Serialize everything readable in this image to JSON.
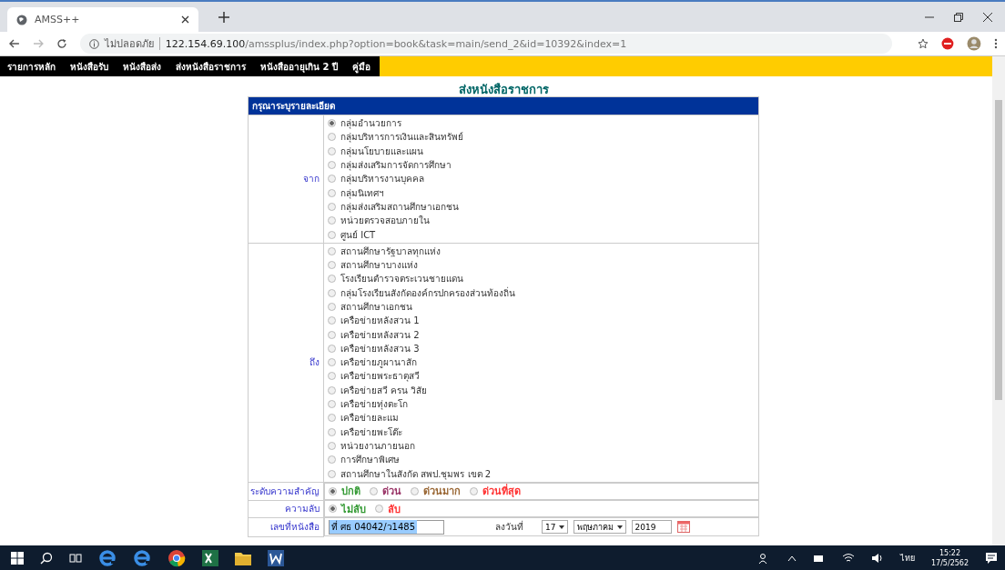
{
  "browser": {
    "tab_title": "AMSS++",
    "security": "ไม่ปลอดภัย",
    "url_host": "122.154.69.100",
    "url_path": "/amssplus/index.php?option=book&task=main/send_2&id=10392&index=1"
  },
  "nav": [
    "รายการหลัก",
    "หนังสือรับ",
    "หนังสือส่ง",
    "ส่งหนังสือราชการ",
    "หนังสืออายุเกิน 2 ปี",
    "คู่มือ"
  ],
  "page_title": "ส่งหนังสือราชการ",
  "form_header": "กรุณาระบุรายละเอียด",
  "from": {
    "label": "จาก",
    "options": [
      {
        "label": "กลุ่มอำนวยการ",
        "selected": true
      },
      {
        "label": "กลุ่มบริหารการเงินและสินทรัพย์",
        "selected": false
      },
      {
        "label": "กลุ่มนโยบายและแผน",
        "selected": false
      },
      {
        "label": "กลุ่มส่งเสริมการจัดการศึกษา",
        "selected": false
      },
      {
        "label": "กลุ่มบริหารงานบุคคล",
        "selected": false
      },
      {
        "label": "กลุ่มนิเทศฯ",
        "selected": false
      },
      {
        "label": "กลุ่มส่งเสริมสถานศึกษาเอกชน",
        "selected": false
      },
      {
        "label": "หน่วยตรวจสอบภายใน",
        "selected": false
      },
      {
        "label": "ศูนย์ ICT",
        "selected": false
      }
    ]
  },
  "to": {
    "label": "ถึง",
    "options": [
      {
        "label": "สถานศึกษารัฐบาลทุกแห่ง",
        "selected": false
      },
      {
        "label": "สถานศึกษาบางแห่ง",
        "selected": false
      },
      {
        "label": "โรงเรียนตำรวจตระเวนชายแดน",
        "selected": false
      },
      {
        "label": "กลุ่มโรงเรียนสังกัดองค์กรปกครองส่วนท้องถิ่น",
        "selected": false
      },
      {
        "label": "สถานศึกษาเอกชน",
        "selected": false
      },
      {
        "label": "เครือข่ายหลังสวน 1",
        "selected": false
      },
      {
        "label": "เครือข่ายหลังสวน 2",
        "selected": false
      },
      {
        "label": "เครือข่ายหลังสวน 3",
        "selected": false
      },
      {
        "label": "เครือข่ายภูผานาสัก",
        "selected": false
      },
      {
        "label": "เครือข่ายพระธาตุสวี",
        "selected": false
      },
      {
        "label": "เครือข่ายสวี ครน วิสัย",
        "selected": false
      },
      {
        "label": "เครือข่ายทุ่งตะโก",
        "selected": false
      },
      {
        "label": "เครือข่ายละแม",
        "selected": false
      },
      {
        "label": "เครือข่ายพะโต๊ะ",
        "selected": false
      },
      {
        "label": "หน่วยงานภายนอก",
        "selected": false
      },
      {
        "label": "การศึกษาพิเศษ",
        "selected": false
      },
      {
        "label": "สถานศึกษาในสังกัด สพป.ชุมพร เขต 2",
        "selected": false
      }
    ]
  },
  "priority": {
    "label": "ระดับความสำคัญ",
    "options": [
      {
        "label": "ปกติ",
        "selected": true,
        "color": "#339933"
      },
      {
        "label": "ด่วน",
        "selected": false,
        "color": "#993366"
      },
      {
        "label": "ด่วนมาก",
        "selected": false,
        "color": "#996633"
      },
      {
        "label": "ด่วนที่สุด",
        "selected": false,
        "color": "#ff3333"
      }
    ]
  },
  "secrecy": {
    "label": "ความลับ",
    "options": [
      {
        "label": "ไม่ลับ",
        "selected": true,
        "color": "#339933"
      },
      {
        "label": "ลับ",
        "selected": false,
        "color": "#ff3333"
      }
    ]
  },
  "doc": {
    "label": "เลขที่หนังสือ",
    "value": "ที่ ศธ 04042/ว1485",
    "date_label": "ลงวันที่",
    "day": "17",
    "month": "พฤษภาคม",
    "year": "2019"
  },
  "taskbar": {
    "language": "ไทย",
    "time": "15:22",
    "date": "17/5/2562"
  }
}
